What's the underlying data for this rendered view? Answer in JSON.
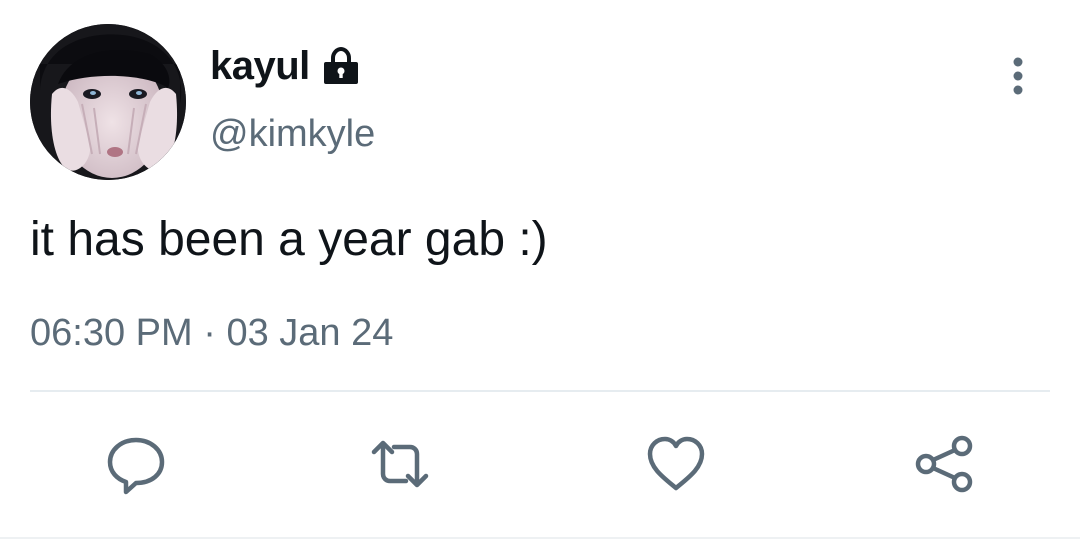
{
  "tweet": {
    "author": {
      "display_name": "kayul",
      "handle": "@kimkyle",
      "protected_icon": "lock-icon",
      "avatar_icon": "avatar"
    },
    "text": "it has been a year gab :)",
    "time": "06:30 PM",
    "separator": "·",
    "date": "03 Jan 24",
    "more_icon": "more-vertical-icon",
    "actions": [
      {
        "name": "reply",
        "icon": "comment-icon"
      },
      {
        "name": "retweet",
        "icon": "retweet-icon"
      },
      {
        "name": "like",
        "icon": "heart-icon"
      },
      {
        "name": "share",
        "icon": "share-icon"
      }
    ]
  },
  "colors": {
    "text_primary": "#0f1419",
    "text_secondary": "#5b6b78",
    "icon": "#5b6b78",
    "divider": "#e6ecf0",
    "background": "#ffffff"
  }
}
